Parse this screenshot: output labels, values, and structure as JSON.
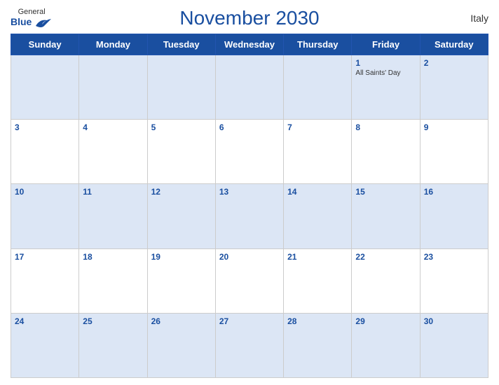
{
  "header": {
    "logo_general": "General",
    "logo_blue": "Blue",
    "title": "November 2030",
    "country": "Italy"
  },
  "days_of_week": [
    "Sunday",
    "Monday",
    "Tuesday",
    "Wednesday",
    "Thursday",
    "Friday",
    "Saturday"
  ],
  "weeks": [
    [
      {
        "day": "",
        "event": ""
      },
      {
        "day": "",
        "event": ""
      },
      {
        "day": "",
        "event": ""
      },
      {
        "day": "",
        "event": ""
      },
      {
        "day": "",
        "event": ""
      },
      {
        "day": "1",
        "event": "All Saints' Day"
      },
      {
        "day": "2",
        "event": ""
      }
    ],
    [
      {
        "day": "3",
        "event": ""
      },
      {
        "day": "4",
        "event": ""
      },
      {
        "day": "5",
        "event": ""
      },
      {
        "day": "6",
        "event": ""
      },
      {
        "day": "7",
        "event": ""
      },
      {
        "day": "8",
        "event": ""
      },
      {
        "day": "9",
        "event": ""
      }
    ],
    [
      {
        "day": "10",
        "event": ""
      },
      {
        "day": "11",
        "event": ""
      },
      {
        "day": "12",
        "event": ""
      },
      {
        "day": "13",
        "event": ""
      },
      {
        "day": "14",
        "event": ""
      },
      {
        "day": "15",
        "event": ""
      },
      {
        "day": "16",
        "event": ""
      }
    ],
    [
      {
        "day": "17",
        "event": ""
      },
      {
        "day": "18",
        "event": ""
      },
      {
        "day": "19",
        "event": ""
      },
      {
        "day": "20",
        "event": ""
      },
      {
        "day": "21",
        "event": ""
      },
      {
        "day": "22",
        "event": ""
      },
      {
        "day": "23",
        "event": ""
      }
    ],
    [
      {
        "day": "24",
        "event": ""
      },
      {
        "day": "25",
        "event": ""
      },
      {
        "day": "26",
        "event": ""
      },
      {
        "day": "27",
        "event": ""
      },
      {
        "day": "28",
        "event": ""
      },
      {
        "day": "29",
        "event": ""
      },
      {
        "day": "30",
        "event": ""
      }
    ]
  ]
}
